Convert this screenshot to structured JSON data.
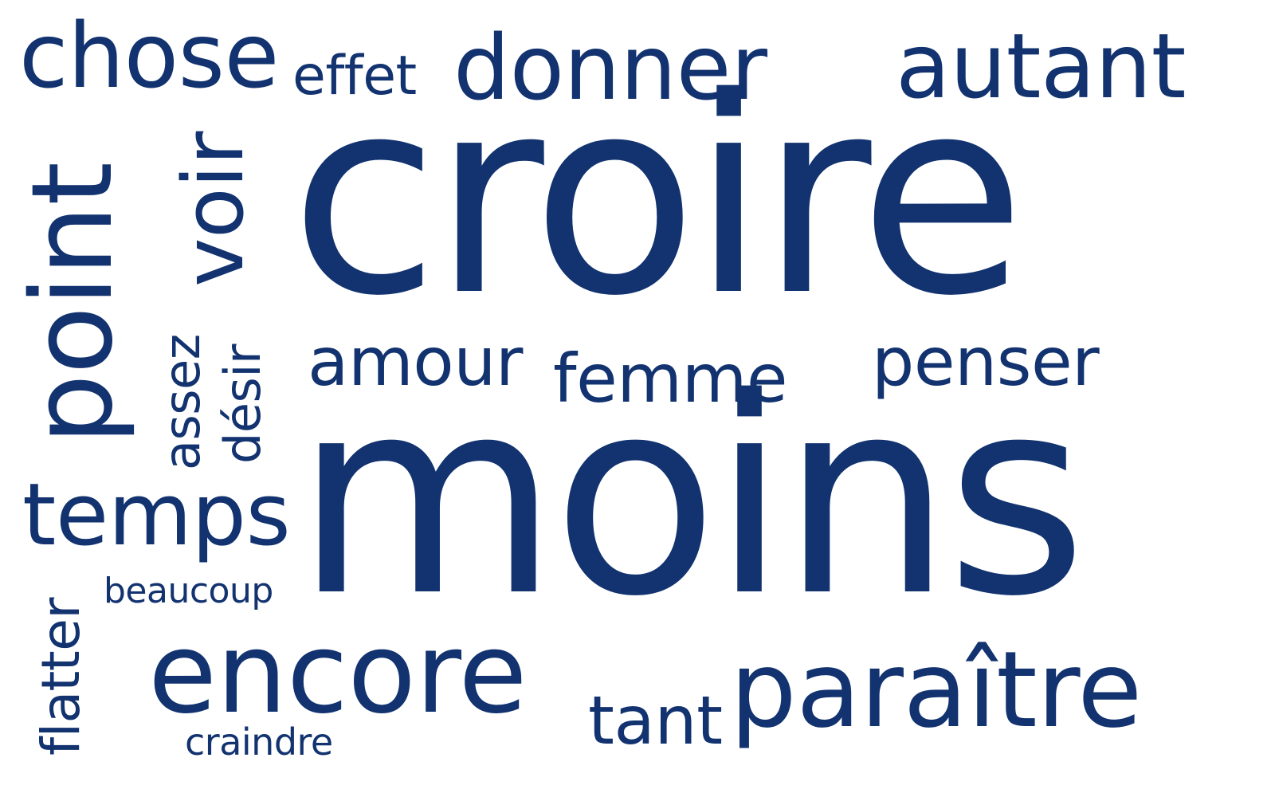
{
  "colors": {
    "text": "#12336f",
    "background": "#ffffff"
  },
  "words": {
    "chose": "chose",
    "effet": "effet",
    "donner": "donner",
    "autant": "autant",
    "croire": "croire",
    "point": "point",
    "voir": "voir",
    "assez": "assez",
    "desir": "désir",
    "amour": "amour",
    "femme": "femme",
    "penser": "penser",
    "moins": "moins",
    "temps": "temps",
    "beaucoup": "beaucoup",
    "flatter": "flatter",
    "encore": "encore",
    "tant": "tant",
    "paraitre": "paraître",
    "craindre": "craindre"
  }
}
